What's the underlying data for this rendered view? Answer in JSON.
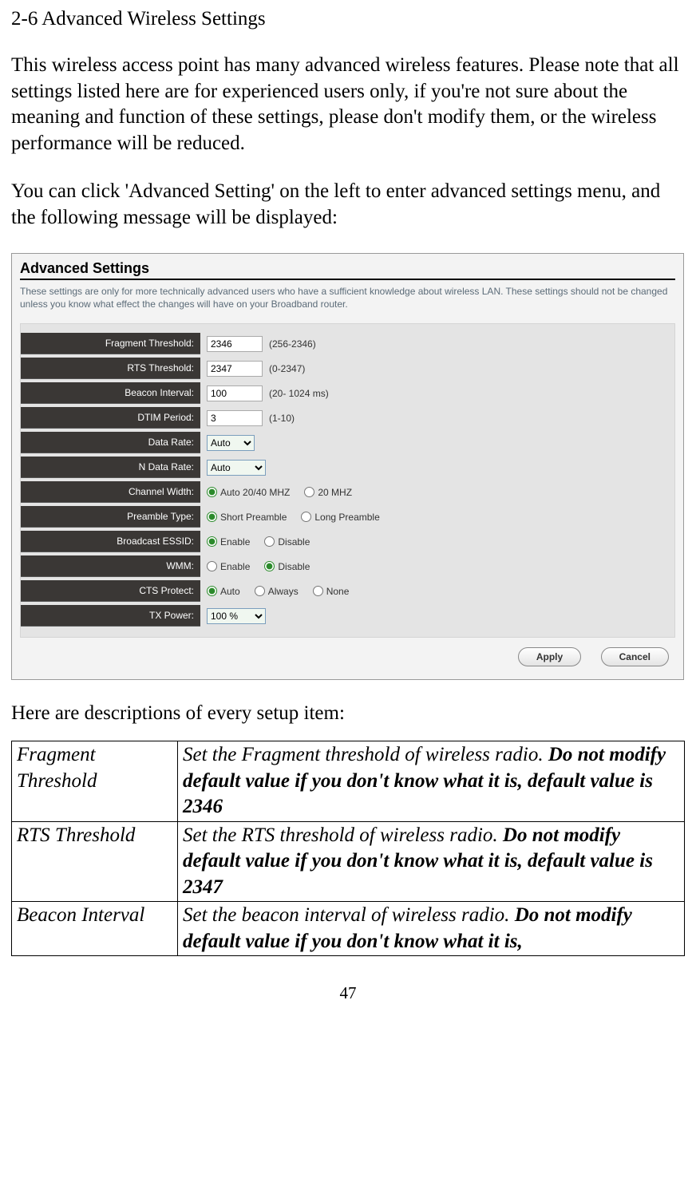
{
  "doc": {
    "section_title": "2-6 Advanced Wireless Settings",
    "para1": "This wireless access point has many advanced wireless features. Please note that all settings listed here are for experienced users only, if you're not sure about the meaning and function of these settings, please don't modify them, or the wireless performance will be reduced.",
    "para2": "You can click 'Advanced Setting' on the left to enter advanced settings menu, and the following message will be displayed:",
    "desc_intro": "Here are descriptions of every setup item:",
    "page_number": "47"
  },
  "screenshot": {
    "title": "Advanced Settings",
    "desc": "These settings are only for more technically advanced users who have a sufficient knowledge about wireless LAN. These settings should not be changed unless you know what effect the changes will have on your Broadband router.",
    "rows": {
      "fragment": {
        "label": "Fragment Threshold:",
        "value": "2346",
        "hint": "(256-2346)"
      },
      "rts": {
        "label": "RTS Threshold:",
        "value": "2347",
        "hint": "(0-2347)"
      },
      "beacon": {
        "label": "Beacon Interval:",
        "value": "100",
        "hint": "(20- 1024 ms)"
      },
      "dtim": {
        "label": "DTIM Period:",
        "value": "3",
        "hint": "(1-10)"
      },
      "dataRate": {
        "label": "Data Rate:",
        "value": "Auto"
      },
      "nDataRate": {
        "label": "N Data Rate:",
        "value": "Auto"
      },
      "channelWidth": {
        "label": "Channel Width:",
        "opt1": "Auto 20/40 MHZ",
        "opt2": "20 MHZ"
      },
      "preamble": {
        "label": "Preamble Type:",
        "opt1": "Short Preamble",
        "opt2": "Long Preamble"
      },
      "broadcast": {
        "label": "Broadcast ESSID:",
        "opt1": "Enable",
        "opt2": "Disable"
      },
      "wmm": {
        "label": "WMM:",
        "opt1": "Enable",
        "opt2": "Disable"
      },
      "cts": {
        "label": "CTS Protect:",
        "opt1": "Auto",
        "opt2": "Always",
        "opt3": "None"
      },
      "txPower": {
        "label": "TX Power:",
        "value": "100 %"
      }
    },
    "buttons": {
      "apply": "Apply",
      "cancel": "Cancel"
    }
  },
  "table": {
    "r1": {
      "name": "Fragment Threshold",
      "desc_plain": "Set the Fragment threshold of wireless radio. ",
      "desc_bold": "Do not modify default value if you don't know what it is, default value is 2346"
    },
    "r2": {
      "name": "RTS Threshold",
      "desc_plain": "Set the RTS threshold of wireless radio. ",
      "desc_bold": "Do not modify default value if you don't know what it is, default value is 2347"
    },
    "r3": {
      "name": "Beacon Interval",
      "desc_plain": "Set the beacon interval of wireless radio. ",
      "desc_bold": "Do not modify default value if you don't know what it is,"
    }
  }
}
